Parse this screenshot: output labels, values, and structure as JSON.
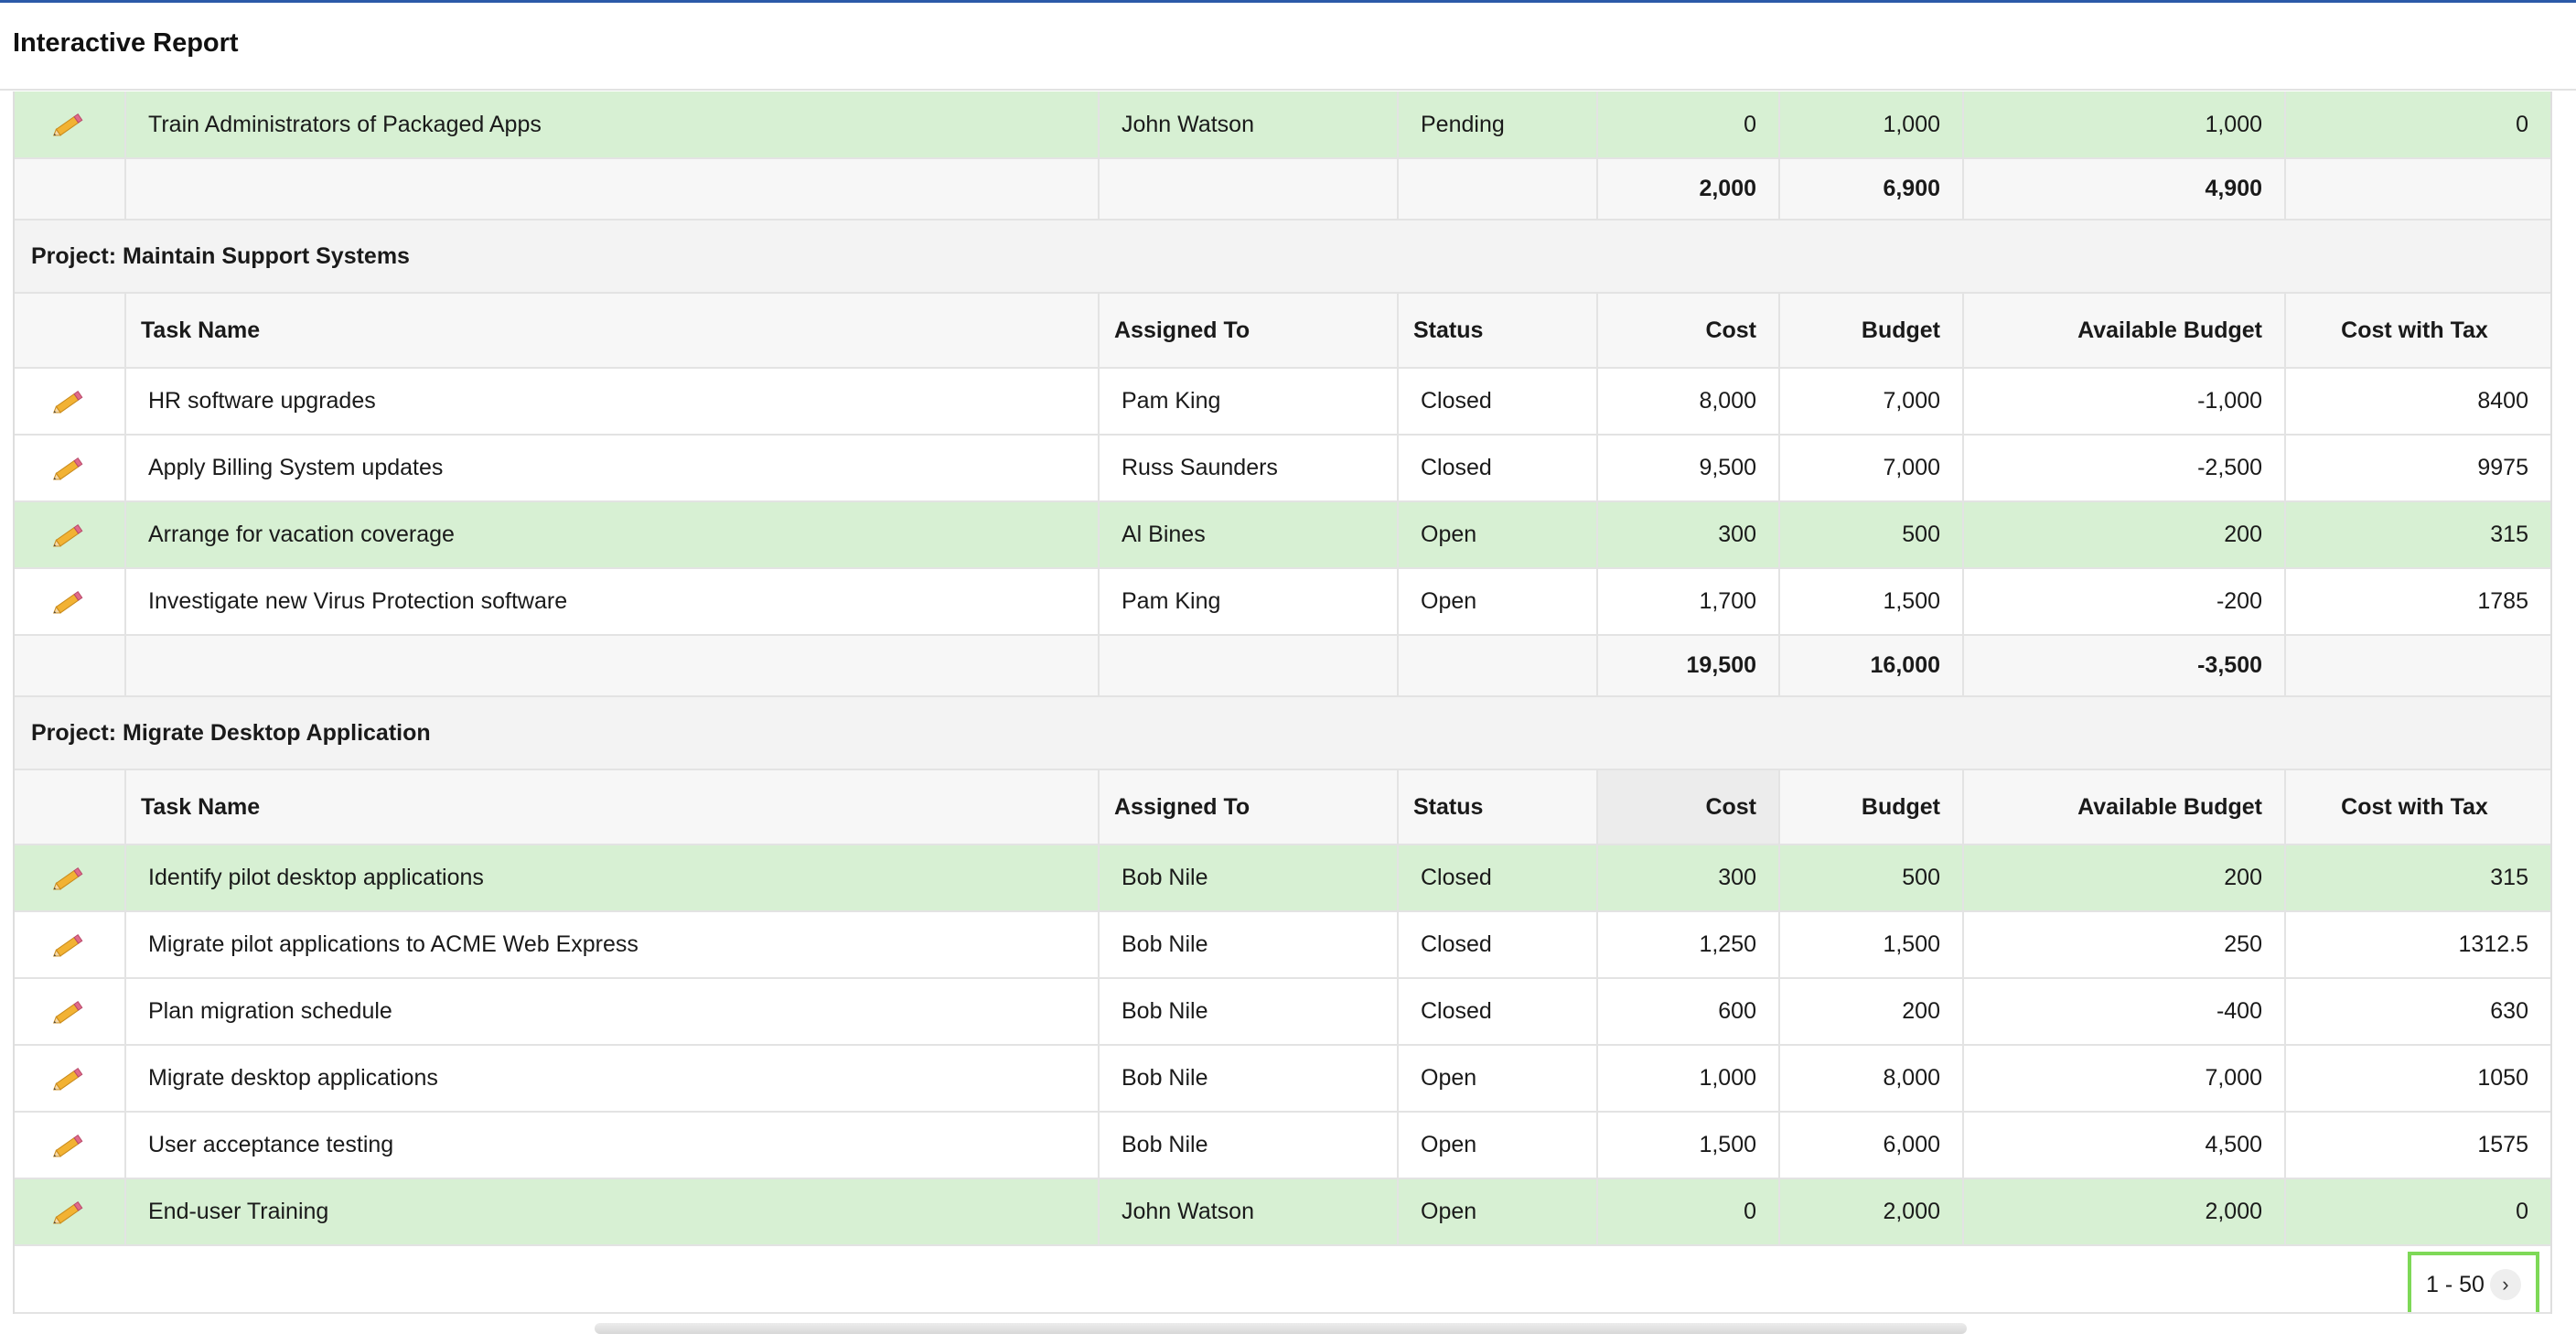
{
  "header": {
    "title": "Interactive Report"
  },
  "columns": {
    "task_name": "Task Name",
    "assigned_to": "Assigned To",
    "status": "Status",
    "cost": "Cost",
    "budget": "Budget",
    "available_budget": "Available Budget",
    "cost_with_tax": "Cost with Tax"
  },
  "groups": [
    {
      "rows": [
        {
          "task": "Train Administrators of Packaged Apps",
          "assigned": "John Watson",
          "status": "Pending",
          "cost": "0",
          "budget": "1,000",
          "available": "1,000",
          "tax": "0"
        }
      ],
      "totals": {
        "cost": "2,000",
        "budget": "6,900",
        "available": "4,900"
      }
    },
    {
      "title": "Project: Maintain Support Systems",
      "rows": [
        {
          "task": "HR software upgrades",
          "assigned": "Pam King",
          "status": "Closed",
          "cost": "8,000",
          "budget": "7,000",
          "available": "-1,000",
          "tax": "8400"
        },
        {
          "task": "Apply Billing System updates",
          "assigned": "Russ Saunders",
          "status": "Closed",
          "cost": "9,500",
          "budget": "7,000",
          "available": "-2,500",
          "tax": "9975"
        },
        {
          "task": "Arrange for vacation coverage",
          "assigned": "Al Bines",
          "status": "Open",
          "cost": "300",
          "budget": "500",
          "available": "200",
          "tax": "315"
        },
        {
          "task": "Investigate new Virus Protection software",
          "assigned": "Pam King",
          "status": "Open",
          "cost": "1,700",
          "budget": "1,500",
          "available": "-200",
          "tax": "1785"
        }
      ],
      "totals": {
        "cost": "19,500",
        "budget": "16,000",
        "available": "-3,500"
      }
    },
    {
      "title": "Project: Migrate Desktop Application",
      "rows": [
        {
          "task": "Identify pilot desktop applications",
          "assigned": "Bob Nile",
          "status": "Closed",
          "cost": "300",
          "budget": "500",
          "available": "200",
          "tax": "315"
        },
        {
          "task": "Migrate pilot applications to ACME Web Express",
          "assigned": "Bob Nile",
          "status": "Closed",
          "cost": "1,250",
          "budget": "1,500",
          "available": "250",
          "tax": "1312.5"
        },
        {
          "task": "Plan migration schedule",
          "assigned": "Bob Nile",
          "status": "Closed",
          "cost": "600",
          "budget": "200",
          "available": "-400",
          "tax": "630"
        },
        {
          "task": "Migrate desktop applications",
          "assigned": "Bob Nile",
          "status": "Open",
          "cost": "1,000",
          "budget": "8,000",
          "available": "7,000",
          "tax": "1050"
        },
        {
          "task": "User acceptance testing",
          "assigned": "Bob Nile",
          "status": "Open",
          "cost": "1,500",
          "budget": "6,000",
          "available": "4,500",
          "tax": "1575"
        },
        {
          "task": "End-user Training",
          "assigned": "John Watson",
          "status": "Open",
          "cost": "0",
          "budget": "2,000",
          "available": "2,000",
          "tax": "0"
        }
      ]
    }
  ],
  "pagination": {
    "range": "1 - 50",
    "next_icon": "chevron-right-icon"
  },
  "colors": {
    "highlight_row": "#d7f0d3",
    "accent_line": "#2b5aa8",
    "pager_outline": "#7ed957"
  }
}
